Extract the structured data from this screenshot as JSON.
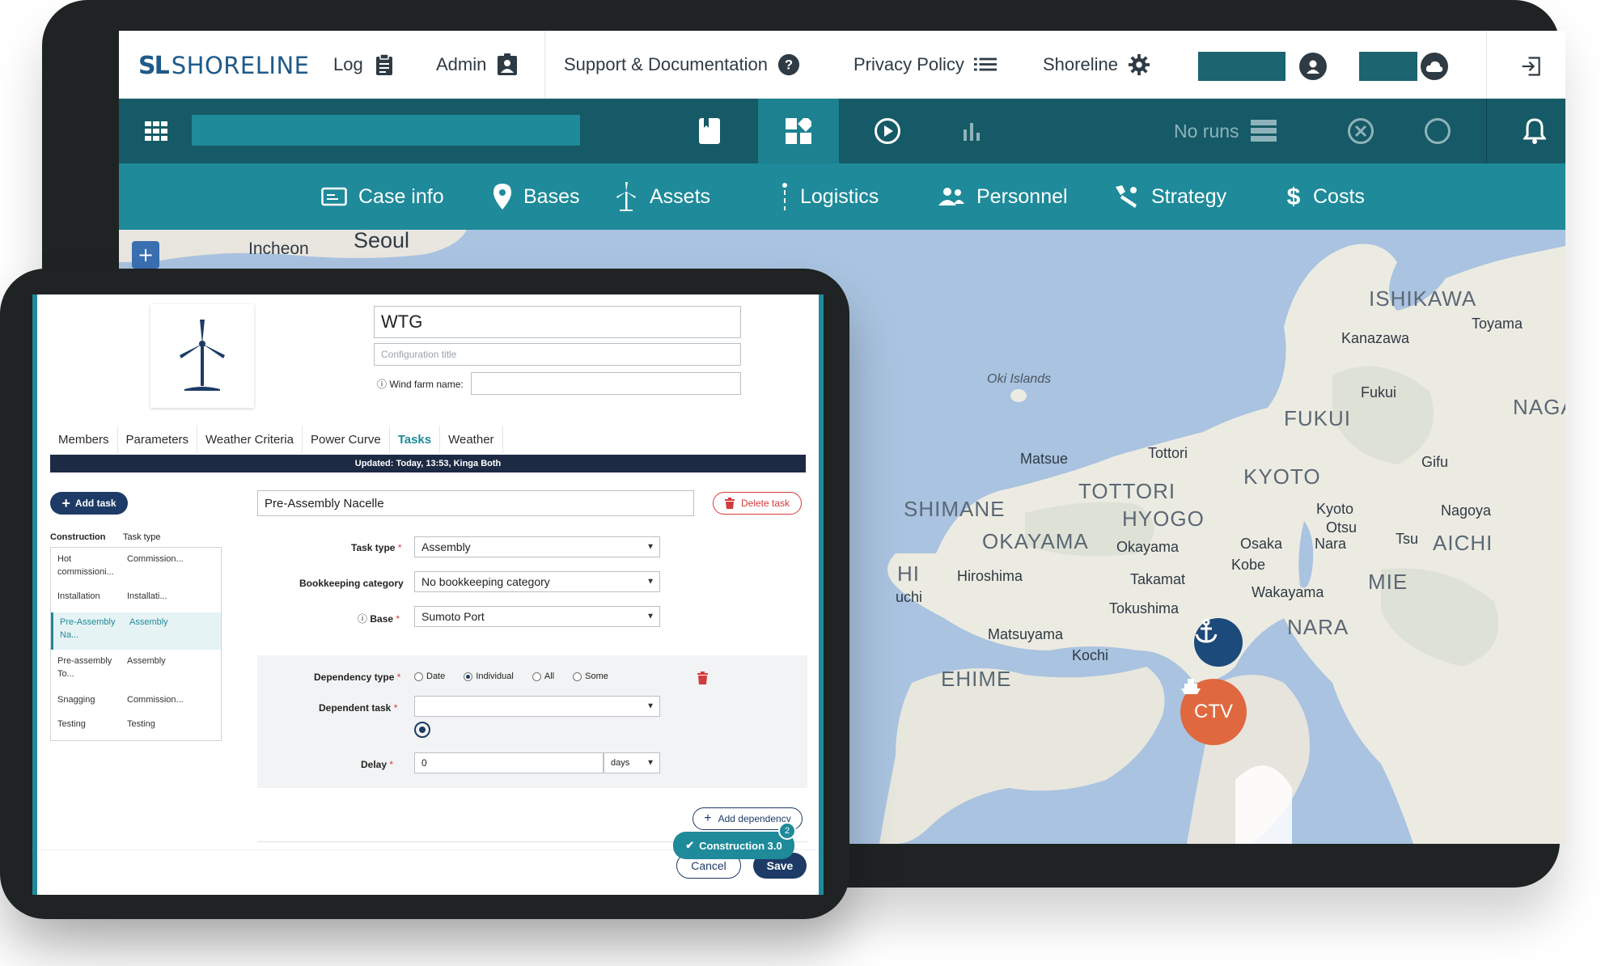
{
  "brand": {
    "mark": "SL",
    "name": "SHORELINE"
  },
  "topnav": {
    "log": "Log",
    "admin": "Admin",
    "support": "Support & Documentation",
    "privacy": "Privacy Policy",
    "shoreline": "Shoreline"
  },
  "toolbar": {
    "no_runs": "No runs"
  },
  "menu": {
    "case_info": "Case info",
    "bases": "Bases",
    "assets": "Assets",
    "logistics": "Logistics",
    "personnel": "Personnel",
    "strategy": "Strategy",
    "costs": "Costs"
  },
  "map": {
    "zoom_in": "+",
    "labels": {
      "seoul": "Seoul",
      "incheon": "Incheon",
      "ishikawa": "ISHIKAWA",
      "toyama": "Toyama",
      "kanazawa": "Kanazawa",
      "oki": "Oki Islands",
      "fukui_city": "Fukui",
      "naga": "NAGA",
      "fukui_pref": "FUKUI",
      "matsue": "Matsue",
      "tottori_city": "Tottori",
      "kyoto_pref": "KYOTO",
      "gifu": "Gifu",
      "shimane": "SHIMANE",
      "tottori_pref": "TOTTORI",
      "kyoto_city": "Kyoto",
      "nagoya": "Nagoya",
      "hyogo": "HYOGO",
      "otsu": "Otsu",
      "okayama_pref": "OKAYAMA",
      "okayama_city": "Okayama",
      "osaka": "Osaka",
      "nara_city": "Nara",
      "tsu": "Tsu",
      "aichi": "AICHI",
      "kobe": "Kobe",
      "hiroshima": "Hiroshima",
      "takamatsu": "Takamat",
      "mie": "MIE",
      "uchi": "uchi",
      "wakayama": "Wakayama",
      "tokushima": "Tokushima",
      "nara_pref": "NARA",
      "matsuyama": "Matsuyama",
      "kochi": "Kochi",
      "ehime": "EHIME",
      "hi": "HI"
    },
    "ctv_label": "CTV"
  },
  "config": {
    "title_value": "WTG",
    "title_placeholder": "Configuration title",
    "windfarm_label": "Wind farm name:"
  },
  "tabs": [
    "Members",
    "Parameters",
    "Weather Criteria",
    "Power Curve",
    "Tasks",
    "Weather"
  ],
  "updated": "Updated: Today, 13:53, Kinga Both",
  "add_task": "Add task",
  "task_name": "Pre-Assembly Nacelle",
  "delete_task": "Delete task",
  "tasklist": {
    "head_construction": "Construction",
    "head_type": "Task type",
    "rows": [
      {
        "name": "Hot commissioni...",
        "type": "Commission..."
      },
      {
        "name": "Installation",
        "type": "Installati..."
      },
      {
        "name": "Pre-Assembly Na...",
        "type": "Assembly"
      },
      {
        "name": "Pre-assembly To...",
        "type": "Assembly"
      },
      {
        "name": "Snagging",
        "type": "Commission..."
      },
      {
        "name": "Testing",
        "type": "Testing"
      }
    ]
  },
  "form": {
    "task_type_label": "Task type",
    "task_type_value": "Assembly",
    "bookkeeping_label": "Bookkeeping category",
    "bookkeeping_value": "No bookkeeping category",
    "base_label": "Base",
    "base_value": "Sumoto Port",
    "dependency_type_label": "Dependency type",
    "dep_options": [
      "Date",
      "Individual",
      "All",
      "Some"
    ],
    "dep_selected": "Individual",
    "dependent_task_label": "Dependent task",
    "delay_label": "Delay",
    "delay_value": "0",
    "delay_unit": "days"
  },
  "add_dependency": "Add dependency",
  "construction_badge": "Construction 3.0",
  "help_count": "2",
  "cancel": "Cancel",
  "save": "Save",
  "colors": {
    "toolbar": "#155a66",
    "menubar": "#1e8a9a",
    "navy": "#1d3b66",
    "accent_orange": "#e0683f",
    "danger": "#d23b3b"
  }
}
